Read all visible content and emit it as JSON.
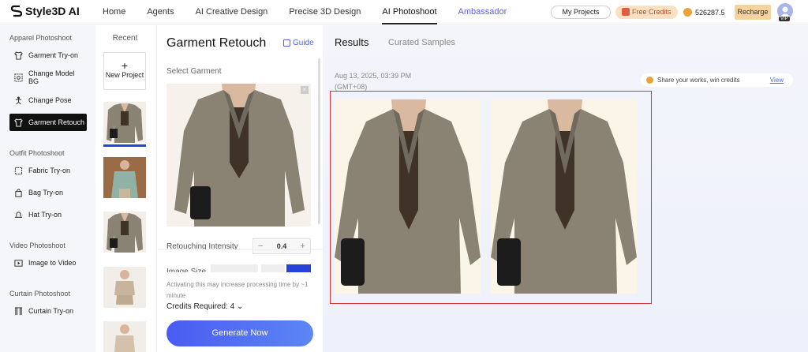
{
  "brand": {
    "name": "Style3D AI"
  },
  "nav": {
    "items": [
      {
        "label": "Home"
      },
      {
        "label": "Agents"
      },
      {
        "label": "AI Creative Design"
      },
      {
        "label": "Precise 3D Design"
      },
      {
        "label": "AI Photoshoot"
      },
      {
        "label": "Ambassador"
      }
    ],
    "active": "AI Photoshoot"
  },
  "account": {
    "my_projects": "My Projects",
    "free_credits": "Free Credits",
    "credits_balance": "526287.5",
    "recharge": "Recharge",
    "vip": "VIP"
  },
  "sidebar": {
    "sections": [
      {
        "title": "Apparel Photoshoot",
        "items": [
          {
            "label": "Garment Try-on",
            "icon": "shirt-icon"
          },
          {
            "label": "Change Model BG",
            "icon": "background-icon"
          },
          {
            "label": "Change Pose",
            "icon": "pose-icon"
          },
          {
            "label": "Garment Retouch",
            "icon": "retouch-icon",
            "active": true
          }
        ]
      },
      {
        "title": "Outfit Photoshoot",
        "items": [
          {
            "label": "Fabric Try-on",
            "icon": "fabric-icon"
          },
          {
            "label": "Bag Try-on",
            "icon": "bag-icon"
          },
          {
            "label": "Hat Try-on",
            "icon": "hat-icon"
          }
        ]
      },
      {
        "title": "Video Photoshoot",
        "items": [
          {
            "label": "Image to Video",
            "icon": "video-icon"
          }
        ]
      },
      {
        "title": "Curtain Photoshoot",
        "items": [
          {
            "label": "Curtain Try-on",
            "icon": "curtain-icon"
          }
        ]
      }
    ]
  },
  "recent": {
    "title": "Recent",
    "new_project": "New Project"
  },
  "panel": {
    "title": "Garment Retouch",
    "guide": "Guide",
    "select_garment": "Select Garment",
    "intensity_label": "Retouching Intensity",
    "intensity_value": "0.4",
    "image_size_label": "Image Size",
    "note": "Activating this may increase processing time by ~1 minute",
    "credits_required": "Credits Required: 4",
    "generate": "Generate Now"
  },
  "results": {
    "tabs": [
      {
        "label": "Results"
      },
      {
        "label": "Curated Samples"
      }
    ],
    "datetime": "Aug 13, 2025, 03:39 PM (GMT+08)",
    "share_text": "Share your works, win credits",
    "share_view": "View"
  },
  "colors": {
    "accent": "#2743d8",
    "highlight_border": "#d93333",
    "amb": "#5b5ef7"
  }
}
